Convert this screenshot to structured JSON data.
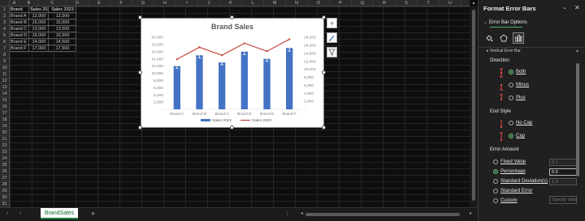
{
  "sheet": {
    "columns": [
      "A",
      "B",
      "C",
      "D",
      "E",
      "F",
      "G",
      "H",
      "I",
      "J",
      "K",
      "L",
      "M",
      "N",
      "O",
      "P",
      "Q",
      "R",
      "S",
      "T",
      "U"
    ],
    "rows": [
      "1",
      "2",
      "3",
      "4",
      "5",
      "6",
      "7",
      "8",
      "9",
      "10",
      "11",
      "12",
      "13",
      "14",
      "15",
      "16",
      "17",
      "18",
      "19",
      "20",
      "21",
      "22",
      "23",
      "24",
      "25",
      "26",
      "27",
      "28",
      "29",
      "30",
      "31"
    ],
    "table": {
      "headers": [
        "Brand",
        "Sales 2022",
        "Sales 2023"
      ],
      "rows": [
        [
          "Brand A",
          "12,000",
          "12,500"
        ],
        [
          "Brand B",
          "15,000",
          "15,500"
        ],
        [
          "Brand C",
          "13,000",
          "13,500"
        ],
        [
          "Brand D",
          "16,000",
          "16,500"
        ],
        [
          "Brand E",
          "14,000",
          "14,500"
        ],
        [
          "Brand F",
          "17,000",
          "17,500"
        ]
      ]
    }
  },
  "chart_data": {
    "type": "bar",
    "title": "Brand Sales",
    "categories": [
      "Brand A",
      "Brand B",
      "Brand C",
      "Brand D",
      "Brand E",
      "Brand F"
    ],
    "series": [
      {
        "name": "Sales 2022",
        "type": "bar",
        "values": [
          12000,
          15000,
          13000,
          16000,
          14000,
          17000
        ],
        "color": "#4472c4"
      },
      {
        "name": "Sales 2023",
        "type": "line",
        "axis": "secondary",
        "values": [
          12500,
          15500,
          13500,
          16500,
          14500,
          17500
        ],
        "color": "#c0392b"
      }
    ],
    "error_bars": {
      "type": "percentage",
      "value": 5.0,
      "direction": "both",
      "end_style": "cap"
    },
    "ylim": [
      0,
      20000
    ],
    "y2lim": [
      0,
      18000
    ],
    "y_ticks": [
      "20,000",
      "18,000",
      "16,000",
      "14,000",
      "12,000",
      "10,000",
      "8,000",
      "6,000",
      "4,000",
      "2,000",
      "-"
    ],
    "y2_ticks": [
      "18,000",
      "16,000",
      "14,000",
      "12,000",
      "10,000",
      "8,000",
      "6,000",
      "4,000",
      "2,000",
      "-"
    ],
    "legend": "bottom",
    "grid": false
  },
  "tabs": {
    "sheet_name": "BrandSales",
    "add": "+",
    "dots": "⋮",
    "prev": "‹",
    "next": "›"
  },
  "pane": {
    "title": "Format Error Bars",
    "options_label": "Error Bar Options",
    "cut_text": "▸ Vertical Error Bar",
    "direction_label": "Direction",
    "direction_options": [
      "Both",
      "Minus",
      "Plus"
    ],
    "direction_selected": "Both",
    "end_style_label": "End Style",
    "end_style_options": [
      "No Cap",
      "Cap"
    ],
    "end_style_selected": "Cap",
    "amount_label": "Error Amount",
    "amount_options": [
      "Fixed Value",
      "Percentage",
      "Standard Deviation(s)",
      "Standard Error",
      "Custom"
    ],
    "amount_selected": "Percentage",
    "fixed_value": "0.1",
    "percentage_value": "5.0",
    "stddev_value": "1.0",
    "specify_button": "Specify Value",
    "accent_color": "#6fcf8a"
  }
}
